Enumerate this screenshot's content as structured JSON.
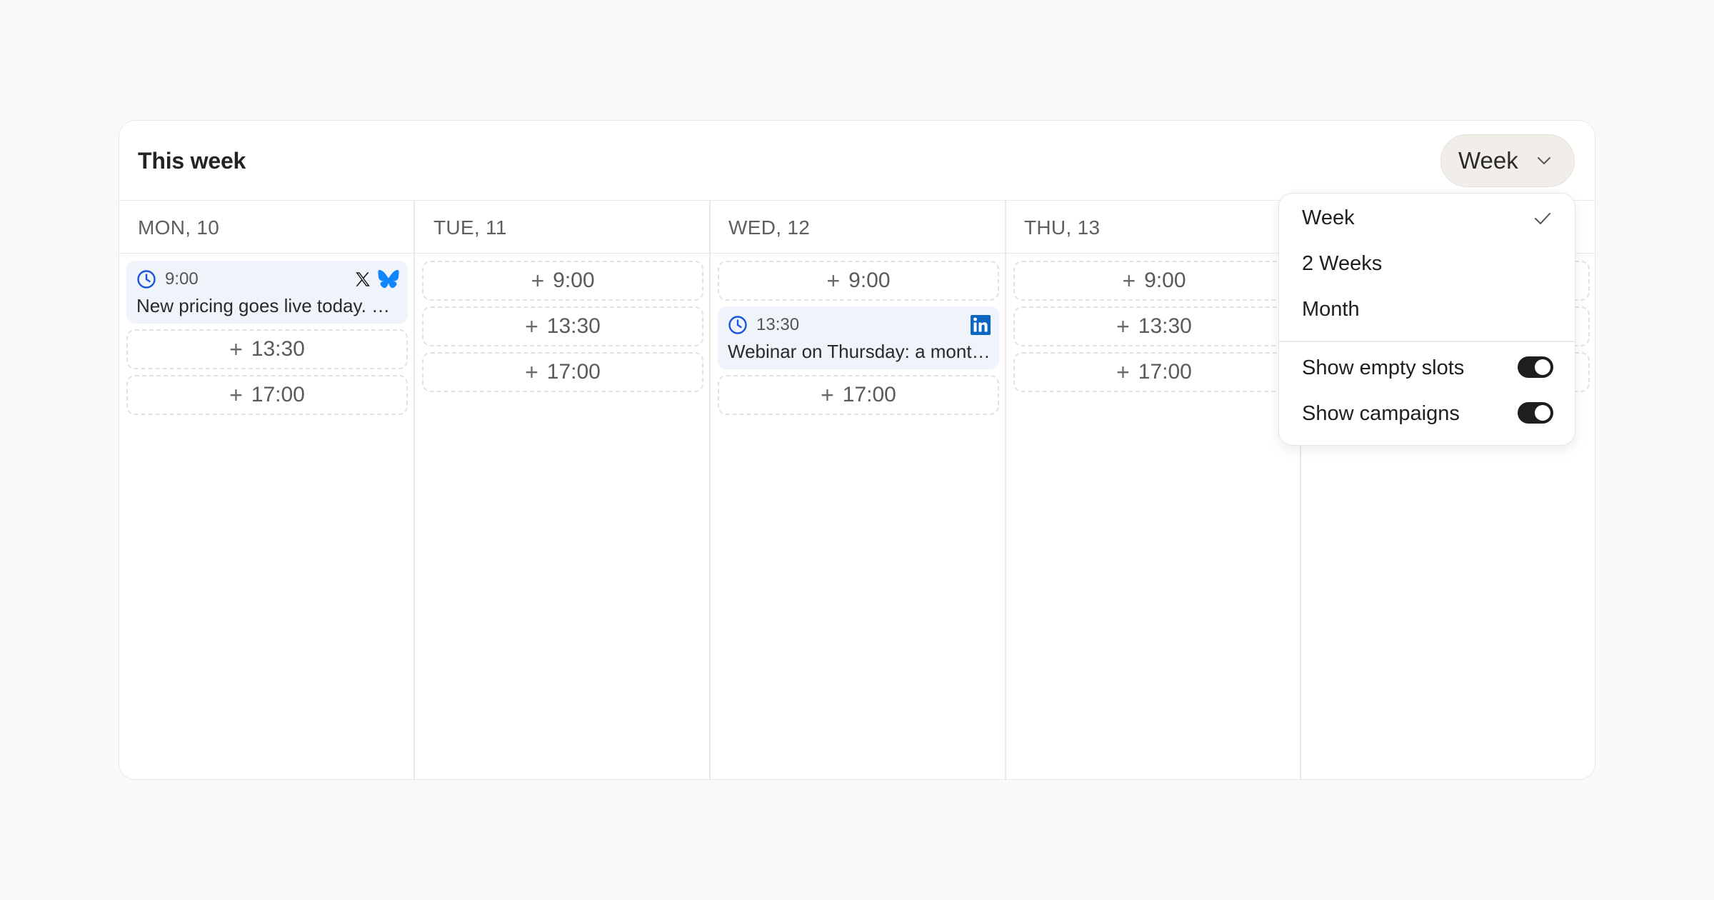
{
  "header": {
    "title": "This week",
    "view_select": "Week"
  },
  "days": [
    {
      "label": "MON, 10"
    },
    {
      "label": "TUE, 11"
    },
    {
      "label": "WED, 12"
    },
    {
      "label": "THU, 13"
    }
  ],
  "columns": {
    "mon": {
      "post": {
        "time": "9:00",
        "text": "New pricing goes live today. S...",
        "networks": [
          "x-icon",
          "bluesky-icon"
        ]
      },
      "slots": [
        "13:30",
        "17:00"
      ]
    },
    "tue": {
      "slots": [
        "9:00",
        "13:30",
        "17:00"
      ]
    },
    "wed": {
      "slot_top": "9:00",
      "post": {
        "time": "13:30",
        "text": "Webinar on Thursday: a month ...",
        "networks": [
          "linkedin-icon"
        ]
      },
      "slot_bottom": "17:00"
    },
    "thu": {
      "slots": [
        "9:00",
        "13:30",
        "17:00"
      ]
    }
  },
  "dropdown": {
    "options": [
      {
        "label": "Week",
        "selected": true
      },
      {
        "label": "2 Weeks",
        "selected": false
      },
      {
        "label": "Month",
        "selected": false
      }
    ],
    "toggles": [
      {
        "label": "Show empty slots",
        "on": true
      },
      {
        "label": "Show campaigns",
        "on": true
      }
    ]
  },
  "colors": {
    "accent_blue": "#1a56db",
    "bluesky": "#1185fe",
    "linkedin": "#0a66c2",
    "post_bg": "#eff4fb"
  }
}
